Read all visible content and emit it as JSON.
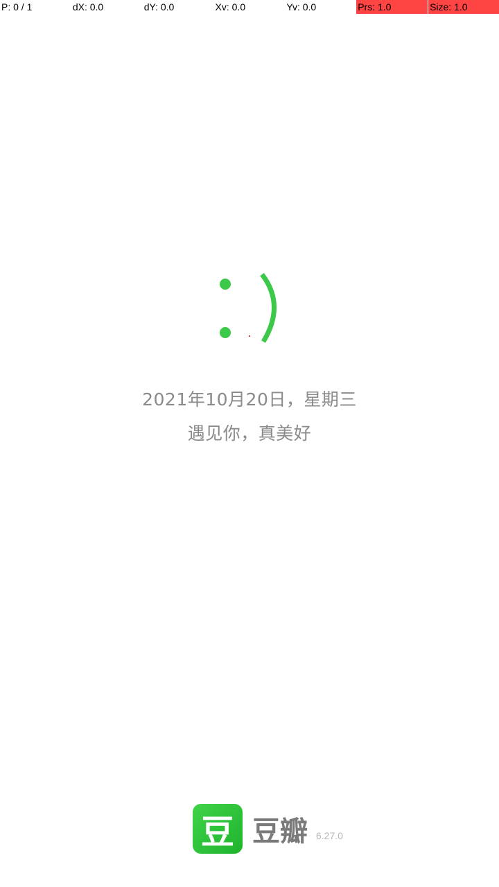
{
  "debug": {
    "pointer": "P: 0 / 1",
    "dx": "dX: 0.0",
    "dy": "dY: 0.0",
    "xv": "Xv: 0.0",
    "yv": "Yv: 0.0",
    "prs": "Prs: 1.0",
    "size": "Size: 1.0",
    "highlight_color": "#ff4444"
  },
  "splash": {
    "smiley_icon": "smiley-face-icon",
    "accent_color": "#3cc94a",
    "date": "2021年10月20日，星期三",
    "greeting": "遇见你，真美好"
  },
  "brand": {
    "logo_glyph": "豆",
    "name": "豆瓣",
    "version": "6.27.0"
  }
}
